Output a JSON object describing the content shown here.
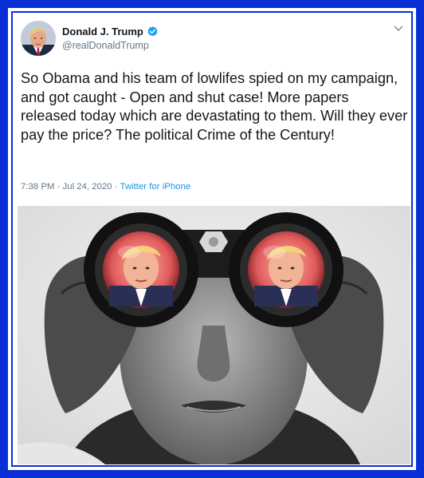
{
  "user": {
    "display_name": "Donald J. Trump",
    "handle": "@realDonaldTrump",
    "verified_icon": "verified-badge-icon"
  },
  "menu_icon": "chevron-down-icon",
  "tweet": {
    "text": "So Obama and his team of lowlifes spied on my campaign, and got caught - Open and shut case! More papers released today which are devastating to them. Will they ever pay the price? The political Crime of the Century!",
    "time": "7:38 PM",
    "separator_1": " · ",
    "date": "Jul 24, 2020",
    "separator_2": " · ",
    "source": "Twitter for iPhone"
  },
  "colors": {
    "frame_border": "#0a2fd6",
    "verified_blue": "#1da1f2",
    "link_blue": "#1b95e0",
    "meta_gray": "#657786",
    "text": "#14171a"
  }
}
